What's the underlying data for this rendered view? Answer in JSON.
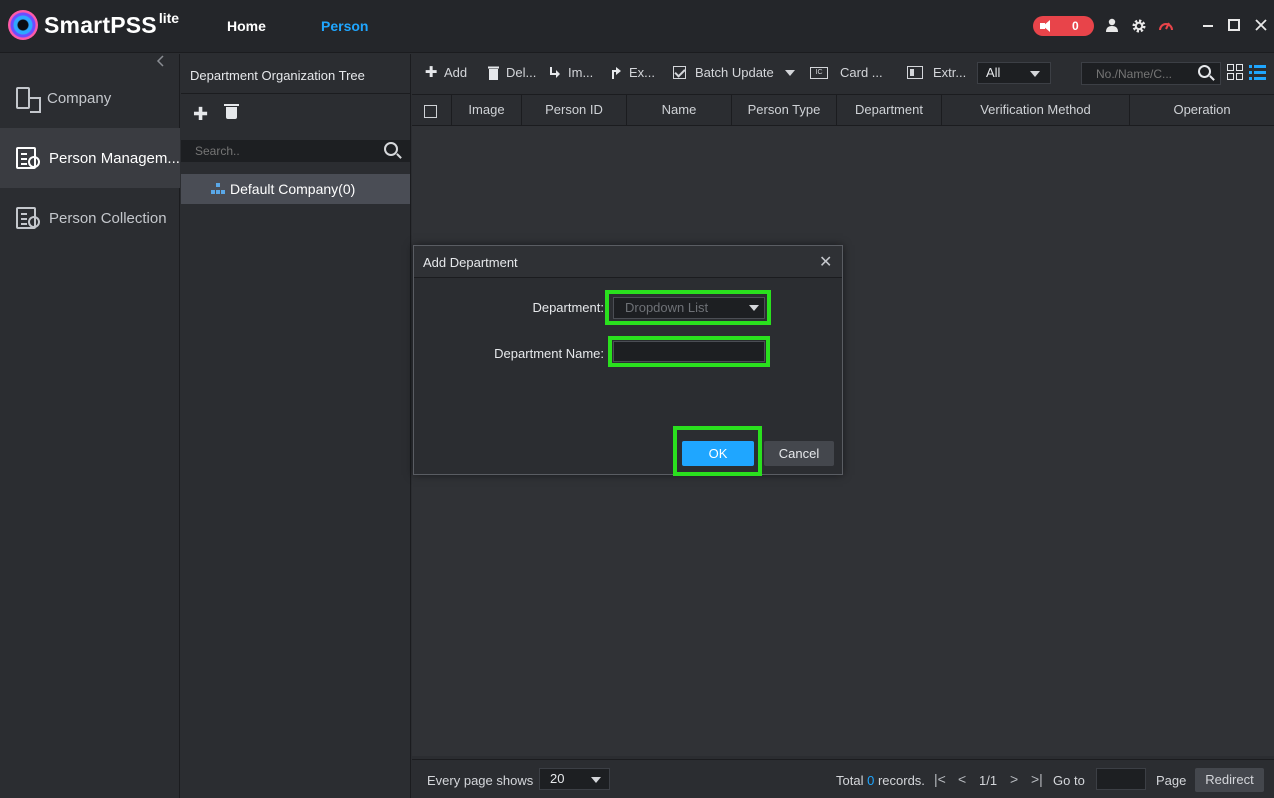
{
  "app": {
    "name": "SmartPSS",
    "edition": "lite"
  },
  "nav": {
    "home": "Home",
    "person": "Person"
  },
  "alarm": {
    "count": "0"
  },
  "sidebar": {
    "items": [
      {
        "label": "Company"
      },
      {
        "label": "Person Managem..."
      },
      {
        "label": "Person Collection"
      }
    ]
  },
  "tree": {
    "title": "Department Organization Tree",
    "search_placeholder": "Search..",
    "root_node": "Default Company(0)"
  },
  "toolbar": {
    "add": "Add",
    "delete": "Del...",
    "import": "Im...",
    "export": "Ex...",
    "batch_update": "Batch Update",
    "card": "Card ...",
    "extract": "Extr...",
    "filter_value": "All",
    "search_placeholder": "No./Name/C...",
    "card_icon_text": "IC"
  },
  "table": {
    "columns": [
      "Image",
      "Person ID",
      "Name",
      "Person Type",
      "Department",
      "Verification Method",
      "Operation"
    ]
  },
  "footer": {
    "page_shows_label": "Every page shows",
    "page_size": "20",
    "total_prefix": "Total",
    "total_count": "0",
    "total_suffix": "records.",
    "page_indicator": "1/1",
    "goto_label": "Go to",
    "page_label": "Page",
    "redirect": "Redirect"
  },
  "modal": {
    "title": "Add Department",
    "department_label": "Department:",
    "department_placeholder": "Dropdown List",
    "department_name_label": "Department Name:",
    "ok": "OK",
    "cancel": "Cancel"
  },
  "colors": {
    "accent": "#1fa6ff",
    "alarm": "#e8444a",
    "highlight": "#2ae01e",
    "background": "#2b2d31"
  }
}
